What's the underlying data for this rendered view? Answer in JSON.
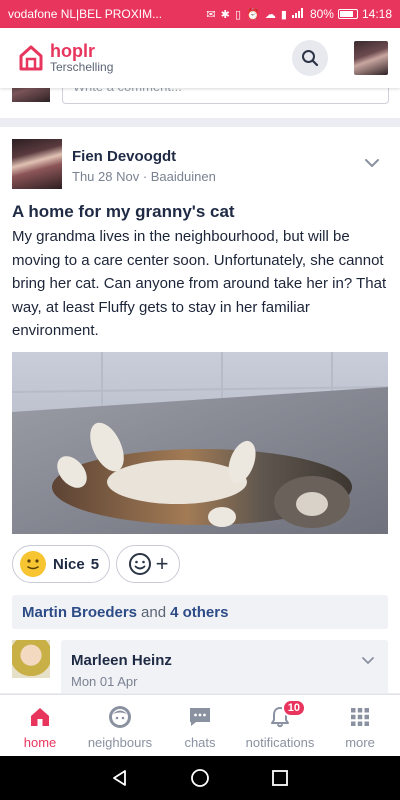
{
  "colors": {
    "accent": "#e8355e",
    "link": "#2d4c87",
    "text": "#1f2a44",
    "muted": "#7a8292"
  },
  "status_bar": {
    "carrier": "vodafone NL|BEL PROXIM...",
    "icons": "✉ ✱ ▯ ⏰ ☁ ▮",
    "signal": "📶",
    "battery": "80%",
    "battery_level": 0.8,
    "time": "14:18"
  },
  "header": {
    "app_name": "hoplr",
    "neighbourhood": "Terschelling",
    "search_icon": "search-icon",
    "avatar_icon": "profile-avatar"
  },
  "prev_post": {
    "comment_placeholder": "Write a comment..."
  },
  "post": {
    "author": "Fien Devoogdt",
    "meta": "Thu 28 Nov · Baaiduinen",
    "title": "A home for my granny's cat",
    "body": "My grandma lives in the neighbourhood, but will be moving to a care center soon. Unfortunately, she cannot bring her cat. Can anyone from around take her in? That way, at least Fluffy gets to stay in her familiar environment.",
    "image_alt": "cat lying on its back",
    "reaction": {
      "label": "Nice",
      "count": "5"
    },
    "add_reaction_plus": "+",
    "likers": {
      "first": "Martin Broeders",
      "and": "and",
      "others": "4 others"
    },
    "comment": {
      "author": "Marleen Heinz",
      "date": "Mon 01 Apr"
    }
  },
  "nav": [
    {
      "label": "home",
      "icon": "home-icon",
      "active": true
    },
    {
      "label": "neighbours",
      "icon": "neighbours-icon"
    },
    {
      "label": "chats",
      "icon": "chats-icon"
    },
    {
      "label": "notifications",
      "icon": "bell-icon",
      "badge": "10"
    },
    {
      "label": "more",
      "icon": "grid-icon"
    }
  ]
}
